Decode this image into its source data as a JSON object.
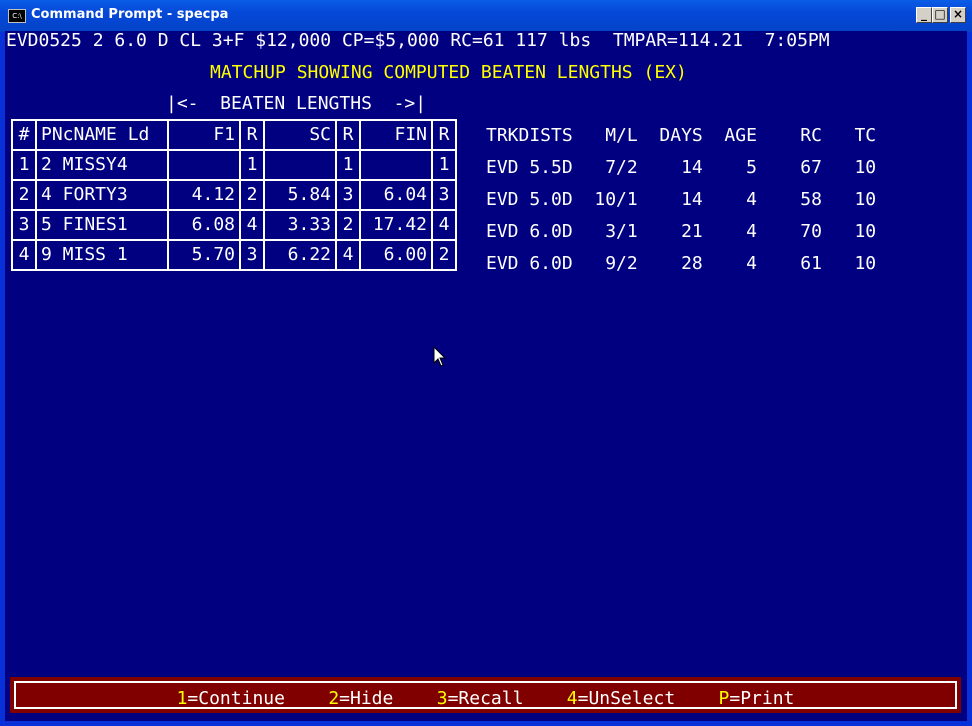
{
  "window": {
    "title": "Command Prompt - specpa",
    "icon_name": "console-icon",
    "icon_glyph": "C:\\"
  },
  "header": {
    "race_line": "EVD0525 2 6.0 D CL 3+F $12,000 CP=$5,000 RC=61 117 lbs  TMPAR=114.21  7:05PM",
    "subtitle": "MATCHUP SHOWING COMPUTED BEATEN LENGTHS (EX)",
    "group_header": "|<-  BEATEN LENGTHS  ->|"
  },
  "table": {
    "columns": [
      "#",
      "PNcNAME Ld",
      "F1",
      "R",
      "SC",
      "R",
      "FIN",
      "R"
    ],
    "rows": [
      {
        "idx": "1",
        "name": "2 MISSY4",
        "f1": "",
        "f1r": "1",
        "sc": "",
        "scr": "1",
        "fin": "",
        "finr": "1"
      },
      {
        "idx": "2",
        "name": "4 FORTY3",
        "f1": "4.12",
        "f1r": "2",
        "sc": "5.84",
        "scr": "3",
        "fin": "6.04",
        "finr": "3"
      },
      {
        "idx": "3",
        "name": "5 FINES1",
        "f1": "6.08",
        "f1r": "4",
        "sc": "3.33",
        "scr": "2",
        "fin": "17.42",
        "finr": "4"
      },
      {
        "idx": "4",
        "name": "9 MISS 1",
        "f1": "5.70",
        "f1r": "3",
        "sc": "6.22",
        "scr": "4",
        "fin": "6.00",
        "finr": "2"
      }
    ]
  },
  "side": {
    "header": "TRKDISTS   M/L  DAYS  AGE    RC   TC",
    "rows": [
      "EVD 5.5D   7/2    14    5    67   10",
      "EVD 5.0D  10/1    14    4    58   10",
      "EVD 6.0D   3/1    21    4    70   10",
      "EVD 6.0D   9/2    28    4    61   10"
    ]
  },
  "status_bar": {
    "items": [
      {
        "key": "1",
        "label": "=Continue"
      },
      {
        "key": "2",
        "label": "=Hide"
      },
      {
        "key": "3",
        "label": "=Recall"
      },
      {
        "key": "4",
        "label": "=UnSelect"
      },
      {
        "key": "P",
        "label": "=Print"
      }
    ]
  },
  "colors": {
    "background": "#000080",
    "text": "#ffffff",
    "highlight_yellow": "#ffff00",
    "highlight_green": "#00ff00",
    "highlight_red": "#ff0000",
    "status_bar": "#800000"
  }
}
